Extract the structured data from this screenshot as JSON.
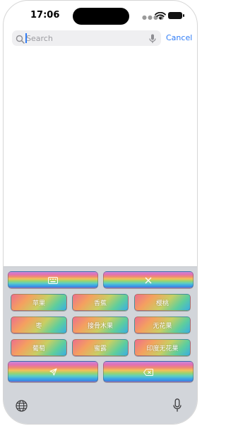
{
  "status_bar": {
    "time": "17:06",
    "signal_icon": "cellular-signal-icon",
    "wifi_icon": "wifi-icon",
    "battery_icon": "battery-icon"
  },
  "search": {
    "placeholder": "Search",
    "value": "",
    "search_icon": "magnifier-icon",
    "mic_icon": "microphone-icon",
    "cancel_label": "Cancel"
  },
  "keyboard": {
    "top_row": [
      {
        "name": "keyboard-toggle-button",
        "icon": "keyboard-icon"
      },
      {
        "name": "close-button",
        "icon": "close-icon"
      }
    ],
    "word_keys": [
      "苹果",
      "香蕉",
      "樱桃",
      "枣",
      "接骨木果",
      "无花果",
      "葡萄",
      "蜜露",
      "印度无花果"
    ],
    "bottom_row": [
      {
        "name": "send-button",
        "icon": "paper-plane-icon"
      },
      {
        "name": "backspace-button",
        "icon": "backspace-icon"
      }
    ],
    "globe_icon": "globe-icon",
    "dictation_icon": "microphone-icon"
  },
  "colors": {
    "accent": "#2f7cf6",
    "keyboard_bg": "#d2d5da",
    "search_bg": "#efeff1"
  }
}
